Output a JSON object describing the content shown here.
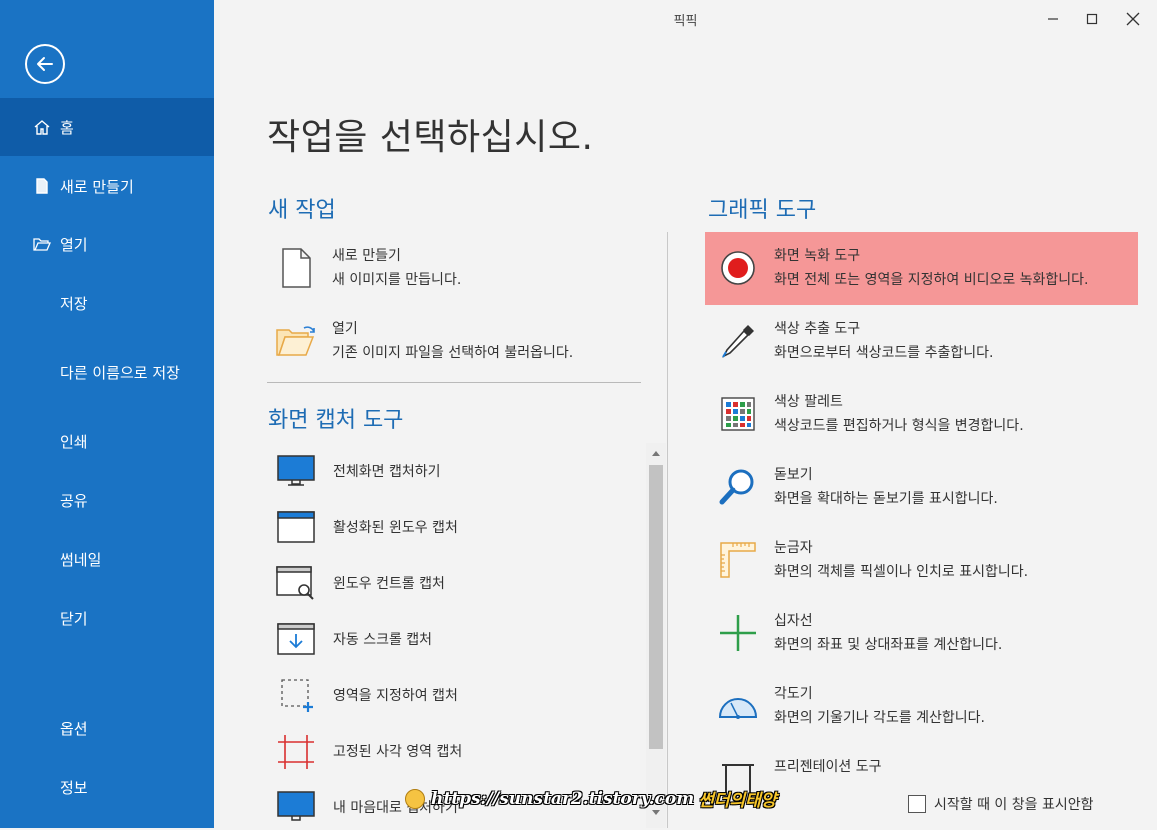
{
  "window": {
    "title": "픽픽"
  },
  "sidebar": {
    "items": [
      {
        "label": "홈"
      },
      {
        "label": "새로 만들기"
      },
      {
        "label": "열기"
      },
      {
        "label": "저장"
      },
      {
        "label": "다른 이름으로 저장"
      },
      {
        "label": "인쇄"
      },
      {
        "label": "공유"
      },
      {
        "label": "썸네일"
      },
      {
        "label": "닫기"
      },
      {
        "label": "옵션"
      },
      {
        "label": "정보"
      }
    ]
  },
  "main": {
    "heading": "작업을 선택하십시오.",
    "new_work": {
      "title": "새 작업",
      "items": [
        {
          "title": "새로 만들기",
          "desc": "새 이미지를 만듭니다."
        },
        {
          "title": "열기",
          "desc": "기존 이미지 파일을 선택하여 불러옵니다."
        }
      ]
    },
    "capture": {
      "title": "화면 캡처 도구",
      "items": [
        {
          "label": "전체화면 캡처하기"
        },
        {
          "label": "활성화된 윈도우 캡처"
        },
        {
          "label": "윈도우 컨트롤 캡처"
        },
        {
          "label": "자동 스크롤 캡처"
        },
        {
          "label": "영역을 지정하여 캡처"
        },
        {
          "label": "고정된 사각 영역 캡처"
        },
        {
          "label": "내 마음대로 캡처하기"
        }
      ]
    },
    "graphic": {
      "title": "그래픽 도구",
      "items": [
        {
          "title": "화면 녹화 도구",
          "desc": "화면 전체 또는 영역을 지정하여 비디오로 녹화합니다."
        },
        {
          "title": "색상 추출 도구",
          "desc": "화면으로부터 색상코드를 추출합니다."
        },
        {
          "title": "색상 팔레트",
          "desc": "색상코드를 편집하거나 형식을 변경합니다."
        },
        {
          "title": "돋보기",
          "desc": "화면을 확대하는 돋보기를 표시합니다."
        },
        {
          "title": "눈금자",
          "desc": "화면의 객체를 픽셀이나 인치로 표시합니다."
        },
        {
          "title": "십자선",
          "desc": "화면의 좌표 및 상대좌표를 계산합니다."
        },
        {
          "title": "각도기",
          "desc": "화면의 기울기나 각도를 계산합니다."
        },
        {
          "title": "프리젠테이션 도구",
          "desc": ""
        }
      ]
    },
    "startup_checkbox": "시작할 때 이 창을 표시안함"
  },
  "watermark": {
    "url": "https://sunstar2.tistory.com",
    "name": "썬더의태양"
  },
  "colors": {
    "sidebar": "#1a73c4",
    "sidebar_active": "#0f5ca8",
    "accent": "#1e6cb4",
    "highlight": "#f59797"
  }
}
